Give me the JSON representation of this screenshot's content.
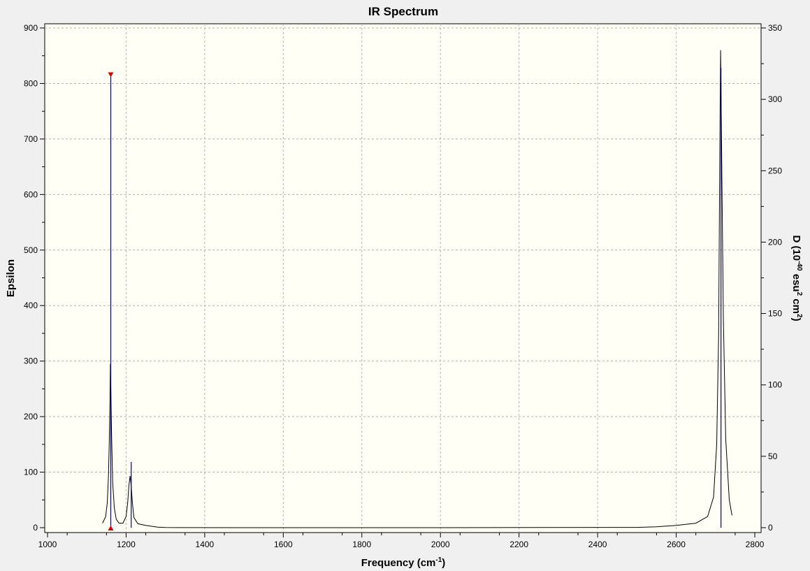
{
  "chart_data": {
    "type": "line",
    "title": "IR Spectrum",
    "xlabel": {
      "main": "Frequency (cm",
      "sup": "-1",
      "close": ")"
    },
    "ylabel_left": "Epsilon",
    "ylabel_right": {
      "a": "D (10",
      "sup1": "-40",
      "b": " esu",
      "sup2": "2",
      "c": " cm",
      "sup3": "2",
      "d": ")"
    },
    "xlim": [
      1000,
      2800
    ],
    "ylim_left": [
      0,
      900
    ],
    "ylim_right": [
      0,
      350
    ],
    "x_ticks": [
      1000,
      1200,
      1400,
      1600,
      1800,
      2000,
      2200,
      2400,
      2600,
      2800
    ],
    "y_left_ticks": [
      0,
      100,
      200,
      300,
      400,
      500,
      600,
      700,
      800,
      900
    ],
    "y_right_ticks": [
      0,
      50,
      100,
      150,
      200,
      250,
      300,
      350
    ],
    "grid": true,
    "colors": {
      "plot_background": "#fffff6",
      "spectrum": "#000000",
      "stick": "#00007a",
      "marker": "#dd0000"
    },
    "spectrum_series": {
      "name": "",
      "points": [
        [
          1140,
          8
        ],
        [
          1148,
          20
        ],
        [
          1152,
          45
        ],
        [
          1155,
          90
        ],
        [
          1157,
          150
        ],
        [
          1159,
          230
        ],
        [
          1160,
          295
        ],
        [
          1161,
          260
        ],
        [
          1163,
          170
        ],
        [
          1166,
          80
        ],
        [
          1170,
          35
        ],
        [
          1175,
          15
        ],
        [
          1182,
          8
        ],
        [
          1192,
          8
        ],
        [
          1200,
          20
        ],
        [
          1204,
          45
        ],
        [
          1207,
          75
        ],
        [
          1210,
          93
        ],
        [
          1213,
          75
        ],
        [
          1216,
          45
        ],
        [
          1220,
          18
        ],
        [
          1230,
          7
        ],
        [
          1250,
          4
        ],
        [
          1280,
          1
        ],
        [
          1300,
          0.3
        ],
        [
          1500,
          0
        ],
        [
          2000,
          0
        ],
        [
          2500,
          0.5
        ],
        [
          2550,
          1.5
        ],
        [
          2600,
          4
        ],
        [
          2650,
          8
        ],
        [
          2680,
          20
        ],
        [
          2695,
          55
        ],
        [
          2703,
          150
        ],
        [
          2708,
          350
        ],
        [
          2711,
          690
        ],
        [
          2713,
          860
        ],
        [
          2716,
          650
        ],
        [
          2720,
          380
        ],
        [
          2726,
          160
        ],
        [
          2735,
          50
        ],
        [
          2742,
          22
        ]
      ]
    },
    "stick_series": {
      "name": "",
      "sticks": [
        {
          "x": 1161,
          "d": 318
        },
        {
          "x": 1213,
          "d": 46
        },
        {
          "x": 2714,
          "d": 322
        }
      ]
    },
    "markers": [
      {
        "x": 1161,
        "epsilon": 815,
        "dir": "down"
      },
      {
        "x": 1161,
        "epsilon": 0,
        "dir": "up"
      }
    ]
  }
}
